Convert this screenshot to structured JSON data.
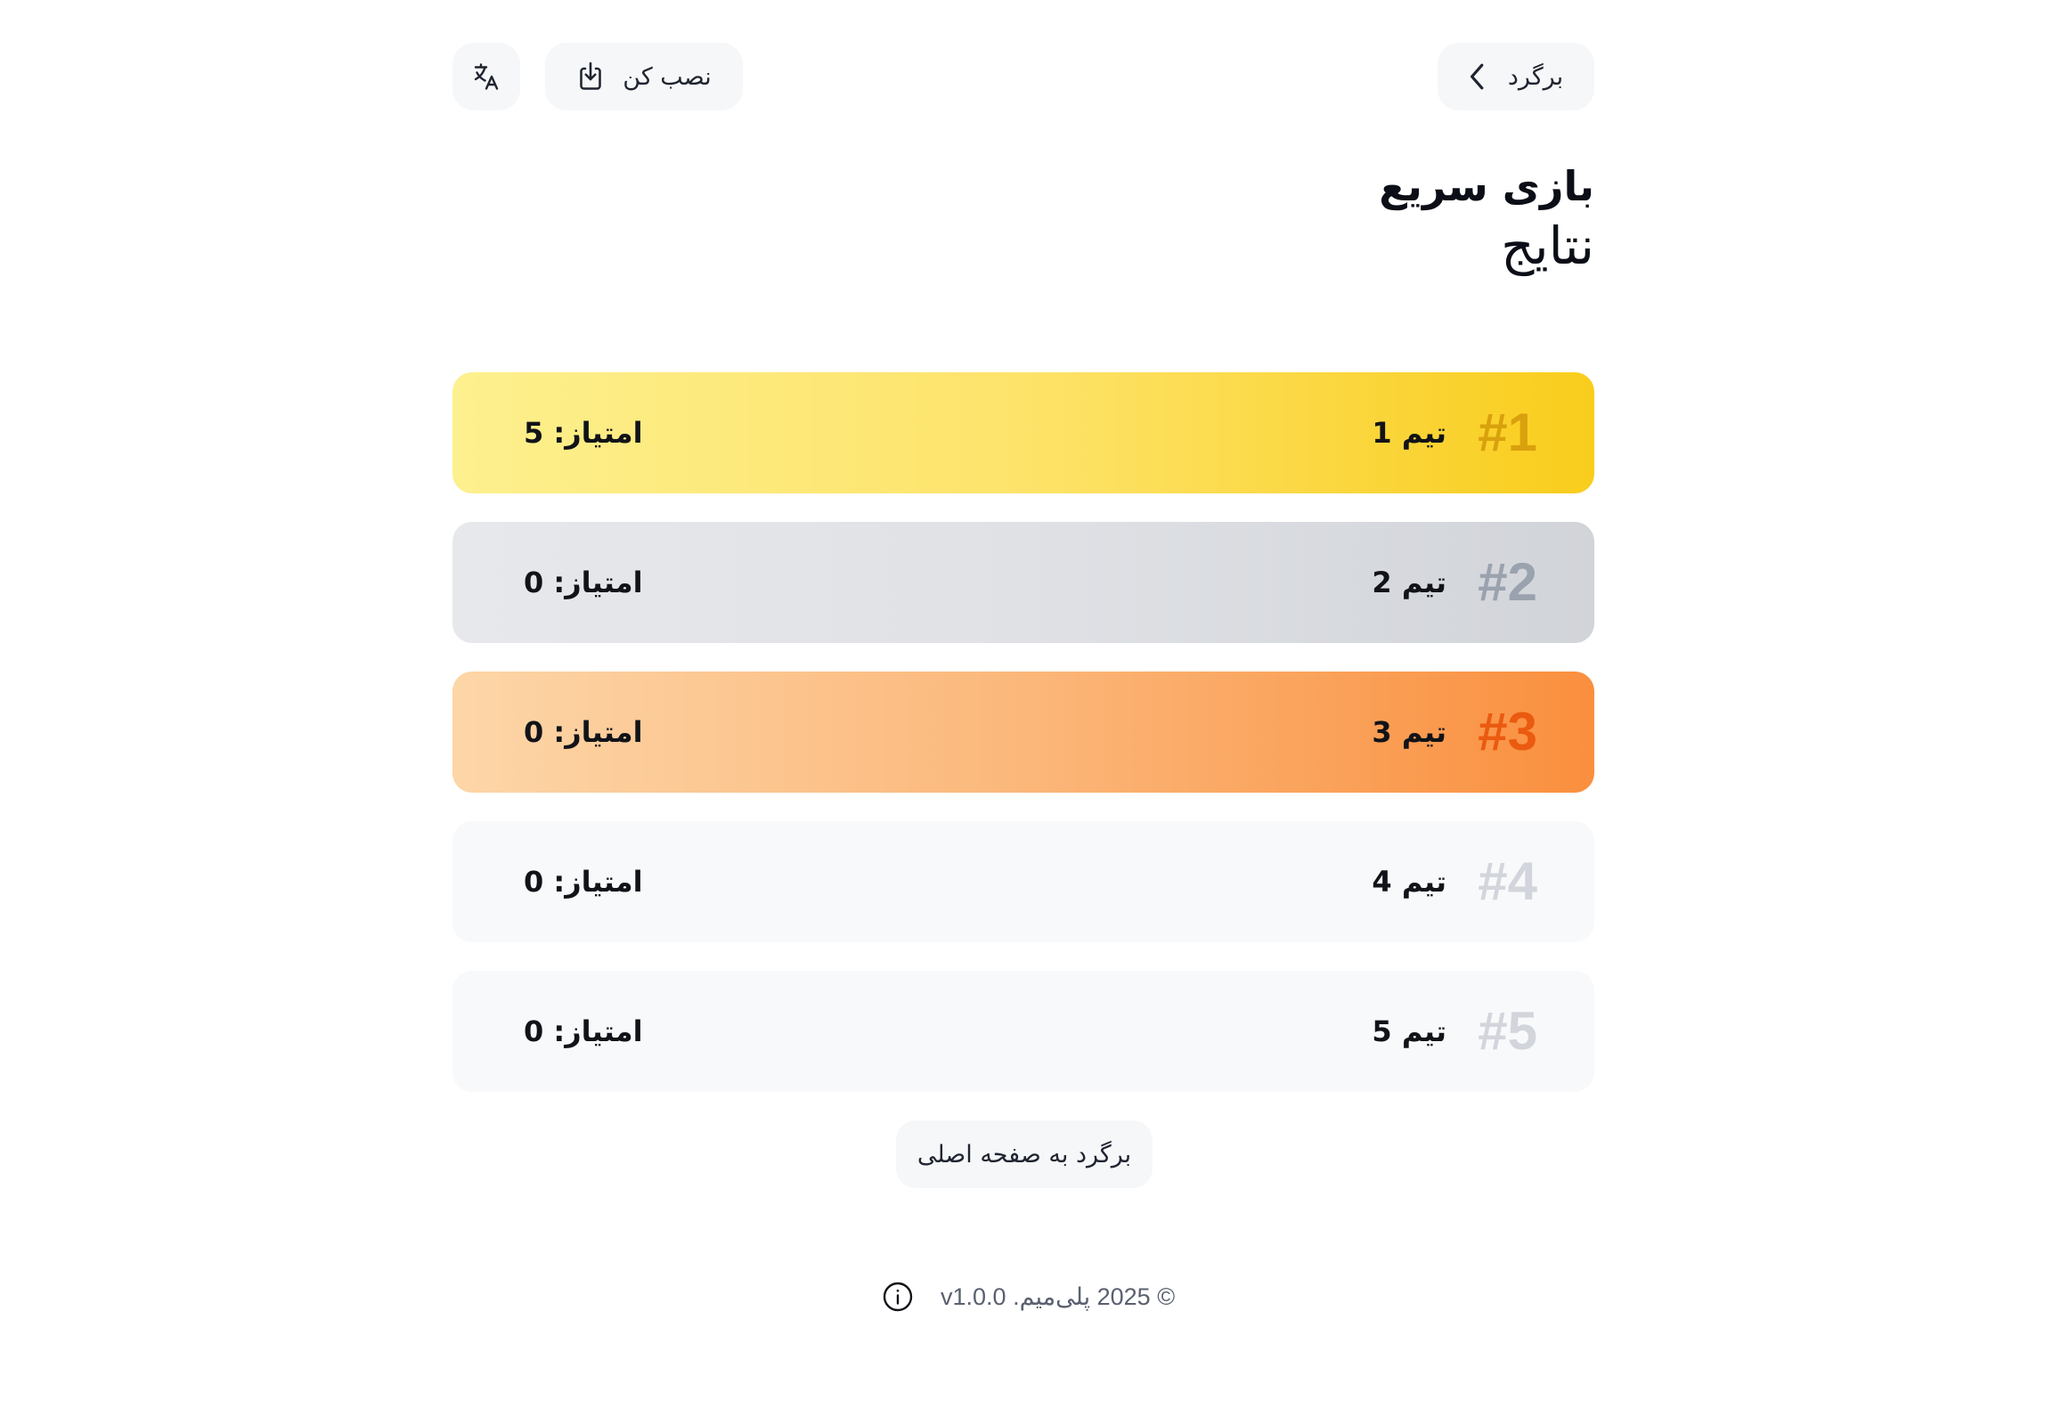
{
  "header": {
    "back_label": "برگرد",
    "install_label": "نصب کن",
    "language_icon": "translate-icon",
    "install_icon": "download-icon",
    "back_icon": "chevron-right-icon"
  },
  "titles": {
    "title": "بازی سریع",
    "subtitle": "نتایج"
  },
  "results": [
    {
      "rank": "#1",
      "team": "تیم 1",
      "score": "امتیاز: 5"
    },
    {
      "rank": "#2",
      "team": "تیم 2",
      "score": "امتیاز: 0"
    },
    {
      "rank": "#3",
      "team": "تیم 3",
      "score": "امتیاز: 0"
    },
    {
      "rank": "#4",
      "team": "تیم 4",
      "score": "امتیاز: 0"
    },
    {
      "rank": "#5",
      "team": "تیم 5",
      "score": "امتیاز: 0"
    }
  ],
  "home_button_label": "برگرد به صفحه اصلی",
  "footer": {
    "text": "© 2025 پلی‌میم. v1.0.0",
    "info_icon": "info-icon"
  },
  "colors": {
    "gold": "#f9cd1c",
    "silver": "#d1d4d9",
    "bronze": "#fa8f3e",
    "neutral": "#f8f9fb"
  }
}
